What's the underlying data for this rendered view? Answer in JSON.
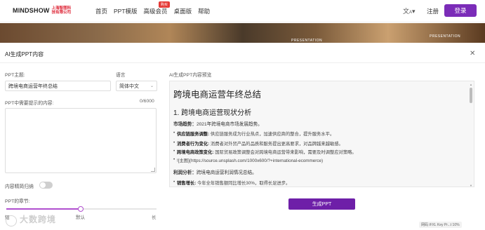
{
  "nav": {
    "logo_main": "MINDSHOW",
    "logo_sub": "上海智图科技有限公司",
    "links": [
      "首页",
      "PPT模版",
      "高级会员",
      "桌面版",
      "帮助"
    ],
    "hot_badge": "购买",
    "lang_icon": "translate-icon",
    "register": "注册",
    "login": "登录"
  },
  "banner": {
    "text1": "PRESENTATION",
    "text2": "PRESENTATION"
  },
  "modal": {
    "title": "AI生成PPT内容",
    "close_icon": "close-icon",
    "topic_label": "PPT主题:",
    "topic_value": "跨境电商运营年终总结",
    "language_label": "语言",
    "language_value": "简体中文",
    "prompt_label": "PPT中需要提示的内容:",
    "prompt_count": "0/6000",
    "prompt_value": "",
    "smart_toggle_label": "内容精简归纳",
    "chapters_label": "PPT的章节:",
    "slider": {
      "min_label": "短",
      "mid_label": "默认",
      "max_label": "长",
      "value_fraction": 0.5
    },
    "preview_label": "AI生成PPT内容预览",
    "generate_button": "生成PPT"
  },
  "preview": {
    "title": "跨境电商运营年终总结",
    "h2": "1. 跨境电商运营现状分析",
    "trend_label": "市场趋势：",
    "trend_text": "2021年跨境电商市场发展趋势。",
    "bullets": [
      {
        "bold": "供应链服务调整:",
        "text": " 供应链服务成为行业热点，加速供应商的整合，提升服务水平。"
      },
      {
        "bold": "消费者行为变化:",
        "text": " 消费者对外贸产品的品质和服务提出更高要求，对品牌越来越敏感。"
      },
      {
        "bold": "跨境电商政策变化:",
        "text": " 国际贸易政策调整会对跨境电商运营带来影响，需要及时调整应对策略。"
      },
      {
        "bold": "",
        "text": "![主图](https://source.unsplash.com/1000x600/?+international-ecommerce)"
      }
    ],
    "profit_label": "利润分析：",
    "profit_text": "跨境电商运营利润情况总结。",
    "bullet_last_bold": "销售增长:",
    "bullet_last_text": " 今年全年销售额同比增长30%，取得长足进步。"
  },
  "watermark": "大数跨境",
  "api_note": "网码 iFXL Key Pr...t 10%"
}
